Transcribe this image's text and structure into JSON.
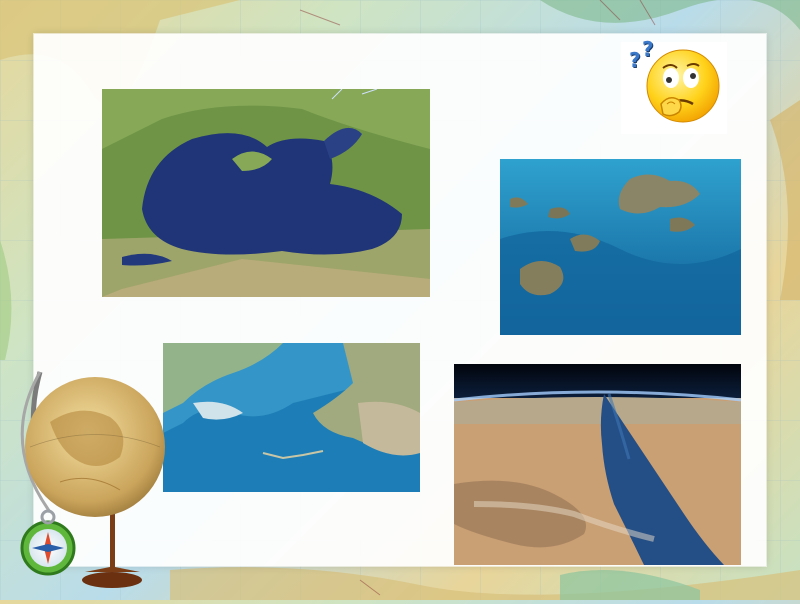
{
  "slide": {
    "emoji": {
      "icon": "thinking-face-icon",
      "question_marks": [
        "?",
        "?"
      ]
    },
    "photos": [
      {
        "name": "black-sea-satellite-photo"
      },
      {
        "name": "coral-reef-underwater-photo"
      },
      {
        "name": "bering-strait-map-photo"
      },
      {
        "name": "red-sea-orbit-photo"
      }
    ],
    "decorations": [
      "globe-icon",
      "compass-icon"
    ]
  },
  "colors": {
    "panel": "#ffffff",
    "sea_deep": "#1f3577",
    "reef_water": "#1a7bb0",
    "desert": "#c99f74"
  }
}
